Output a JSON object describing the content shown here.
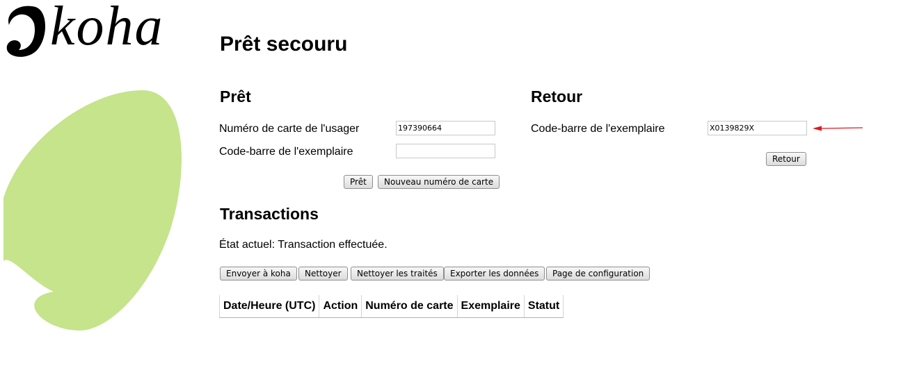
{
  "logo": {
    "text": "koha",
    "icon": "koha-leaf-mark"
  },
  "page": {
    "title": "Prêt secouru"
  },
  "checkout": {
    "heading": "Prêt",
    "patron_card_label": "Numéro de carte de l'usager",
    "patron_card_value": "197390664",
    "item_barcode_label": "Code-barre de l'exemplaire",
    "item_barcode_value": "",
    "checkout_button": "Prêt",
    "new_card_button": "Nouveau numéro de carte"
  },
  "checkin": {
    "heading": "Retour",
    "item_barcode_label": "Code-barre de l'exemplaire",
    "item_barcode_value": "X0139829X",
    "checkin_button": "Retour"
  },
  "transactions": {
    "heading": "Transactions",
    "status": "État actuel: Transaction effectuée.",
    "buttons": {
      "send": "Envoyer à koha",
      "clear": "Nettoyer",
      "clear_processed": "Nettoyer les traités",
      "export": "Exporter les données",
      "config": "Page de configuration"
    },
    "columns": [
      "Date/Heure (UTC)",
      "Action",
      "Numéro de carte",
      "Exemplaire",
      "Statut"
    ]
  },
  "colors": {
    "leaf_green": "#c5e48b",
    "annotation_arrow": "#e0181b"
  }
}
